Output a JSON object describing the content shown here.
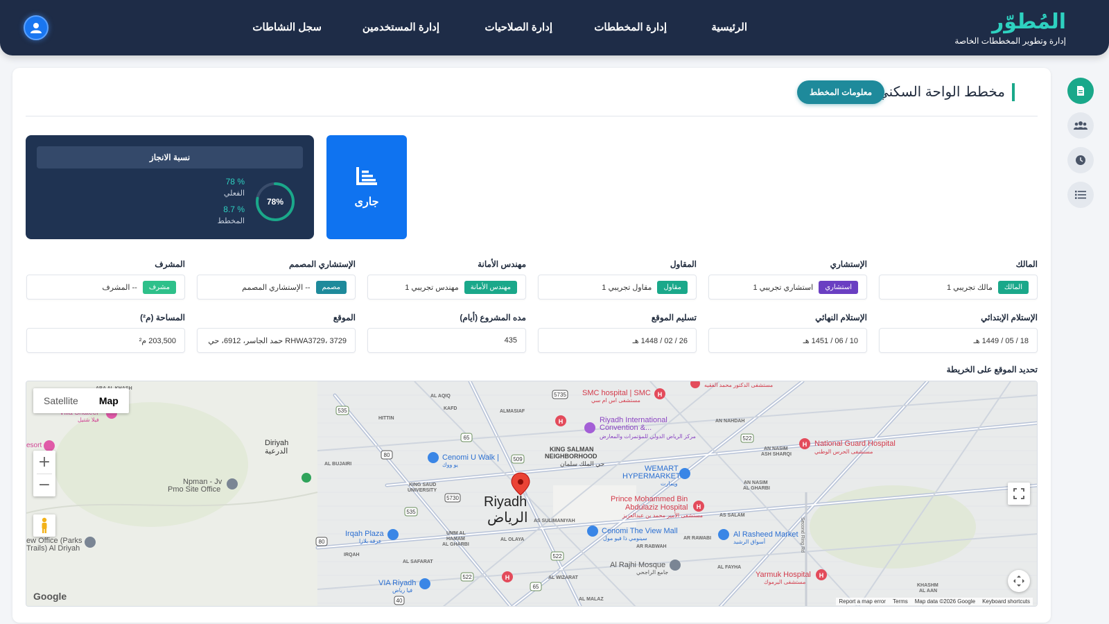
{
  "brand": {
    "title": "المُطوّر",
    "subtitle": "إدارة وتطوير المخططات الخاصة"
  },
  "nav": {
    "home": "الرئيسية",
    "plans": "إدارة المخططات",
    "permissions": "إدارة الصلاحيات",
    "users": "إدارة المستخدمين",
    "activity": "سجل النشاطات"
  },
  "page": {
    "title": "مخطط الواحة السكني",
    "info_button": "معلومات المخطط"
  },
  "progress": {
    "header": "نسبة الانجاز",
    "actual_value": "% 78",
    "actual_label": "الفعلي",
    "planned_value": "% 8.7",
    "planned_label": "المخطط",
    "ring_text": "78%",
    "ring_fraction": 0.78
  },
  "status": {
    "label": "جارى"
  },
  "fields": [
    {
      "label": "المالك",
      "value": "مالك تجريبي 1",
      "tag": "المالك",
      "tag_color": "#1aa88a"
    },
    {
      "label": "الإستشاري",
      "value": "استشاري تجريبي 1",
      "tag": "استشاري",
      "tag_color": "#6a3fc2"
    },
    {
      "label": "المقاول",
      "value": "مقاول تجريبي 1",
      "tag": "مقاول",
      "tag_color": "#1aa88a"
    },
    {
      "label": "مهندس الأمانة",
      "value": "مهندس تجريبي 1",
      "tag": "مهندس الأمانة",
      "tag_color": "#1aa88a"
    },
    {
      "label": "الإستشاري المصمم",
      "value": "-- الإستشاري المصمم",
      "tag": "مصمم",
      "tag_color": "#1e8a9b"
    },
    {
      "label": "المشرف",
      "value": "-- المشرف",
      "tag": "مشرف",
      "tag_color": "#2ec08a"
    }
  ],
  "fields2": [
    {
      "label": "الإستلام الإبتدائي",
      "value": "18 / 05 / 1449 هـ"
    },
    {
      "label": "الإستلام النهائي",
      "value": "10 / 06 / 1451 هـ"
    },
    {
      "label": "تسليم الموقع",
      "value": "26 / 02 / 1448 هـ"
    },
    {
      "label": "مده المشروع (أيام)",
      "value": "435"
    },
    {
      "label": "الموقع",
      "value": "RHWA3729، 3729 حمد الجاسر، 6912، حي ال"
    },
    {
      "label": "المساحة (م²)",
      "value": "203,500 م²"
    }
  ],
  "map_section_label": "تحديد الموقع على الخريطة",
  "map": {
    "type_satellite": "Satellite",
    "type_map": "Map",
    "google": "Google",
    "attribution": [
      "Report a map error",
      "Terms",
      "Map data ©2026 Google",
      "Keyboard shortcuts"
    ],
    "labels": {
      "riyadh_en": "Riyadh",
      "riyadh_ar": "الرياض",
      "diriyah_en": "Diriyah",
      "diriyah_ar": "الدرعية",
      "king_salman_1": "KING SALMAN",
      "king_salman_2": "NEIGHBORHOOD",
      "king_salman_ar": "حي الملك سلمان",
      "smc": "SMC hospital | SMC",
      "smc_ar": "مستشفى اس ام سي",
      "ric": "Riyadh International",
      "ric2": "Convention &...",
      "ric_ar": "مركز الرياض الدولي للمؤتمرات والمعارض",
      "cenomi_walk": "Cenomi U Walk |",
      "cenomi_walk_ar": "يو ووك",
      "wemart": "WEMART",
      "wemart2": "HYPERMARKET",
      "wemart_ar": "ويمارت",
      "pmb": "Prince Mohammed Bin",
      "pmb2": "Abdulaziz Hospital",
      "pmb_ar": "مستشفى الأمير محمد بن عبدالعزيز",
      "national_guard": "National Guard Hospital",
      "national_guard_ar": "مستشفى الحرس الوطني",
      "cenomi_view": "Cenomi The View Mall",
      "cenomi_view_ar": "سينومي ذا فيو مول",
      "rasheed": "Al Rasheed Market",
      "rasheed_ar": "أسواق الرشيد",
      "rajhi": "Al Rajhi Mosque",
      "rajhi_ar": "جامع الراجحي",
      "yarmuk": "Yarmuk Hospital",
      "yarmuk_ar": "مستشفى اليرموك",
      "irqah": "Irqah Plaza",
      "irqah_ar": "عرقة بلازا",
      "via": "VIA Riyadh",
      "via_ar": "فيا رياض",
      "npman": "Npman - Jv",
      "npman2": "Pmo Site Office",
      "office_parks": "ew Office (Parks",
      "office_parks2": "Trails) Al Driyah",
      "villa": "Villa Shateel",
      "villa_ar": "فيلا شتيل",
      "esort": "esort",
      "hittin": "HITTIN",
      "al_aqiq": "AL AQIQ",
      "kafd": "KAFD",
      "almasiaf": "ALMASIAF",
      "al_bujairi": "AL BUJAIRI",
      "ks_university": "KING SAUD",
      "ks_university2": "UNIVERSITY",
      "as_sulimaniyah": "AS SULIMANIYAH",
      "an_nahdah": "AN NAHDAH",
      "an_nasim_sharqi": "AN NASIM",
      "an_nasim_sharqi2": "ASH SHARQI",
      "an_nasim_gharbi": "AN NASIM",
      "an_nasim_gharbi2": "AL GHARBI",
      "as_salam": "AS SALAM",
      "ar_rawabi": "AR RAWABI",
      "ar_rabwah": "AR RABWAH",
      "al_olaya": "AL OLAYA",
      "umm_al_hamam": "UMM AL",
      "umm_al_hamam2": "HAMAM",
      "umm_al_hamam3": "AL GHARBI",
      "irqah_n": "IRQAH",
      "al_safarat": "AL SAFARAT",
      "al_wizarat": "AL WIZARAT",
      "al_malaz": "AL MALAZ",
      "al_fayha": "AL FAYHA",
      "khashm": "KHASHM",
      "khashm2": "AL AAN",
      "dr_hospital": "مستشفى الدكتور محمد الفقيه",
      "second_ring": "Second Ring Rd",
      "ab_al_kash": "ABA AL KHASH",
      "r535": "535",
      "r65": "65",
      "r80": "80",
      "r509": "509",
      "r5730": "5730",
      "r5735": "5735",
      "r522": "522",
      "r40": "40",
      "r65b": "65",
      "r522b": "522",
      "r522c": "522",
      "r80b": "80",
      "r535b": "535"
    }
  }
}
